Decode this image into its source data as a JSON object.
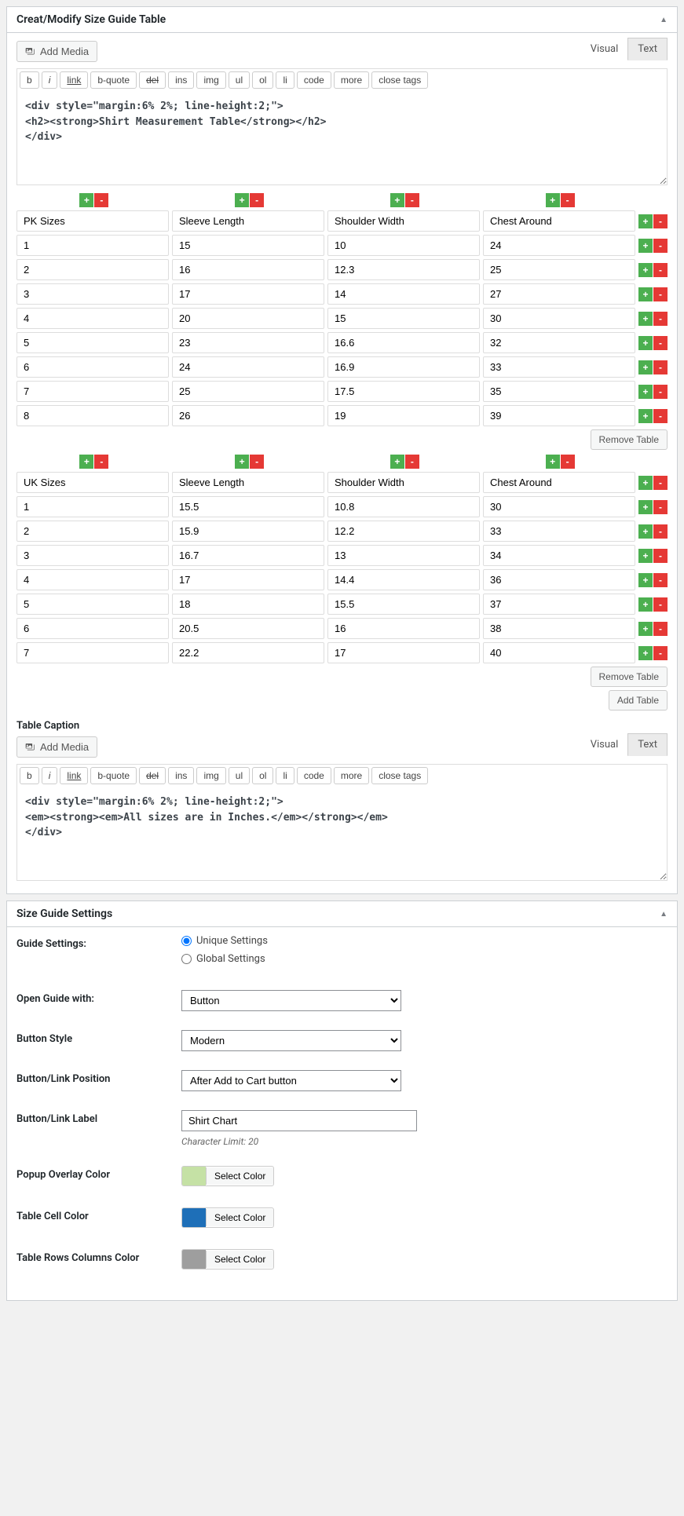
{
  "panel1": {
    "title": "Creat/Modify Size Guide Table"
  },
  "editor": {
    "add_media": "Add Media",
    "tab_visual": "Visual",
    "tab_text": "Text",
    "buttons": [
      "b",
      "i",
      "link",
      "b-quote",
      "del",
      "ins",
      "img",
      "ul",
      "ol",
      "li",
      "code",
      "more",
      "close tags"
    ]
  },
  "code1": "<div style=\"margin:6% 2%; line-height:2;\">\n<h2><strong>Shirt Measurement Table</strong></h2>\n</div>",
  "table1": {
    "headers": [
      "PK Sizes",
      "Sleeve Length",
      "Shoulder Width",
      "Chest Around"
    ],
    "rows": [
      [
        "1",
        "15",
        "10",
        "24"
      ],
      [
        "2",
        "16",
        "12.3",
        "25"
      ],
      [
        "3",
        "17",
        "14",
        "27"
      ],
      [
        "4",
        "20",
        "15",
        "30"
      ],
      [
        "5",
        "23",
        "16.6",
        "32"
      ],
      [
        "6",
        "24",
        "16.9",
        "33"
      ],
      [
        "7",
        "25",
        "17.5",
        "35"
      ],
      [
        "8",
        "26",
        "19",
        "39"
      ]
    ]
  },
  "table2": {
    "headers": [
      "UK Sizes",
      "Sleeve Length",
      "Shoulder Width",
      "Chest Around"
    ],
    "rows": [
      [
        "1",
        "15.5",
        "10.8",
        "30"
      ],
      [
        "2",
        "15.9",
        "12.2",
        "33"
      ],
      [
        "3",
        "16.7",
        "13",
        "34"
      ],
      [
        "4",
        "17",
        "14.4",
        "36"
      ],
      [
        "5",
        "18",
        "15.5",
        "37"
      ],
      [
        "6",
        "20.5",
        "16",
        "38"
      ],
      [
        "7",
        "22.2",
        "17",
        "40"
      ]
    ]
  },
  "remove_table": "Remove Table",
  "add_table": "Add Table",
  "caption_label": "Table Caption",
  "code2": "<div style=\"margin:6% 2%; line-height:2;\">\n<em><strong><em>All sizes are in Inches.</em></strong></em>\n</div>",
  "panel2": {
    "title": "Size Guide Settings"
  },
  "settings": {
    "guide_settings": "Guide Settings:",
    "unique": "Unique Settings",
    "global": "Global Settings",
    "open_with": "Open Guide with:",
    "open_with_val": "Button",
    "btn_style": "Button Style",
    "btn_style_val": "Modern",
    "btn_pos": "Button/Link Position",
    "btn_pos_val": "After Add to Cart button",
    "btn_label": "Button/Link Label",
    "btn_label_val": "Shirt Chart",
    "char_limit": "Character Limit: 20",
    "overlay": "Popup Overlay Color",
    "cell": "Table Cell Color",
    "rows_cols": "Table Rows Columns Color",
    "select_color": "Select Color",
    "overlay_color": "#c5e1a5",
    "cell_color": "#1e6fb8",
    "rows_color": "#9e9e9e"
  }
}
